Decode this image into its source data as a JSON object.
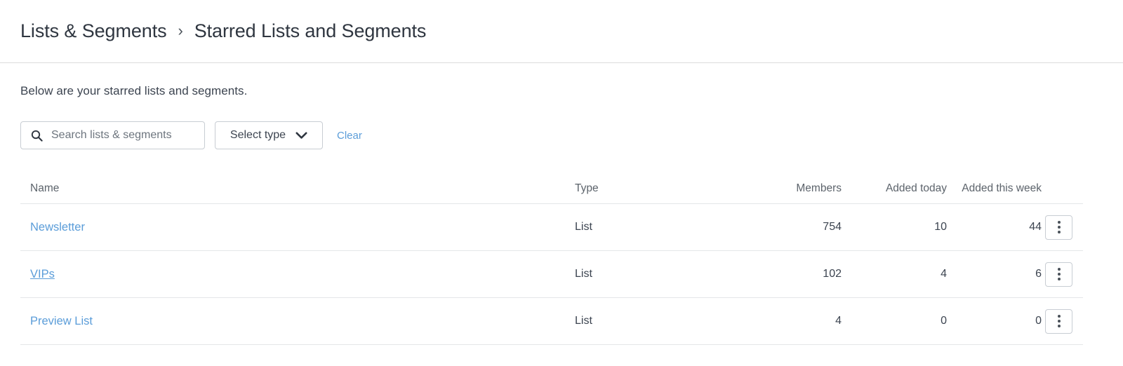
{
  "breadcrumb": {
    "parent": "Lists & Segments",
    "separator": "›",
    "current": "Starred Lists and Segments"
  },
  "description": "Below are your starred lists and segments.",
  "toolbar": {
    "search_placeholder": "Search lists & segments",
    "search_value": "",
    "search_icon": "search-icon",
    "select_type_label": "Select type",
    "select_type_icon": "chevron-down-icon",
    "clear_label": "Clear"
  },
  "table": {
    "columns": [
      "Name",
      "Type",
      "Members",
      "Added today",
      "Added this week"
    ],
    "rows": [
      {
        "name": "Newsletter",
        "type": "List",
        "members": "754",
        "added_today": "10",
        "added_this_week": "44",
        "hovered": false,
        "menu_icon": "kebab-menu-icon"
      },
      {
        "name": "VIPs",
        "type": "List",
        "members": "102",
        "added_today": "4",
        "added_this_week": "6",
        "hovered": true,
        "menu_icon": "kebab-menu-icon"
      },
      {
        "name": "Preview List",
        "type": "List",
        "members": "4",
        "added_today": "0",
        "added_this_week": "0",
        "hovered": false,
        "menu_icon": "kebab-menu-icon"
      }
    ]
  },
  "colors": {
    "link": "#5b9dd9",
    "text": "#3c4450",
    "muted": "#5c636b",
    "border": "#c8cdd3",
    "divider": "#e4e6e8"
  }
}
